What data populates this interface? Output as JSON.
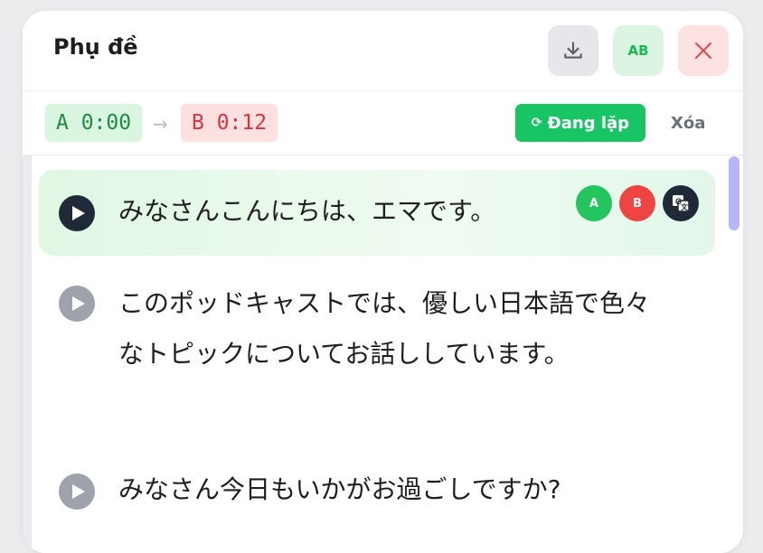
{
  "header": {
    "title": "Phụ đề",
    "ab_label": "AB"
  },
  "ab_bar": {
    "point_a": "A 0:00",
    "arrow": "→",
    "point_b": "B 0:12",
    "loop_icon": "⟳",
    "loop_label": "Đang lặp",
    "clear_label": "Xóa"
  },
  "subtitles": [
    {
      "text": "みなさんこんにちは、エマです。",
      "active": true
    },
    {
      "text": "このポッドキャストでは、優しい日本語で色々なトピックについてお話ししています。",
      "active": false
    },
    {
      "text": "みなさん今日もいかがお過ごしですか?",
      "active": false
    }
  ],
  "row_actions": {
    "set_a": "A",
    "set_b": "B"
  },
  "icons": {
    "download": "download-icon",
    "close": "close-icon",
    "play": "play-icon",
    "translate": "translate-icon"
  },
  "colors": {
    "accent_green": "#18c464",
    "a_green": "#1f8a43",
    "b_red": "#d9343f",
    "scrollbar": "#b7b5f6"
  }
}
